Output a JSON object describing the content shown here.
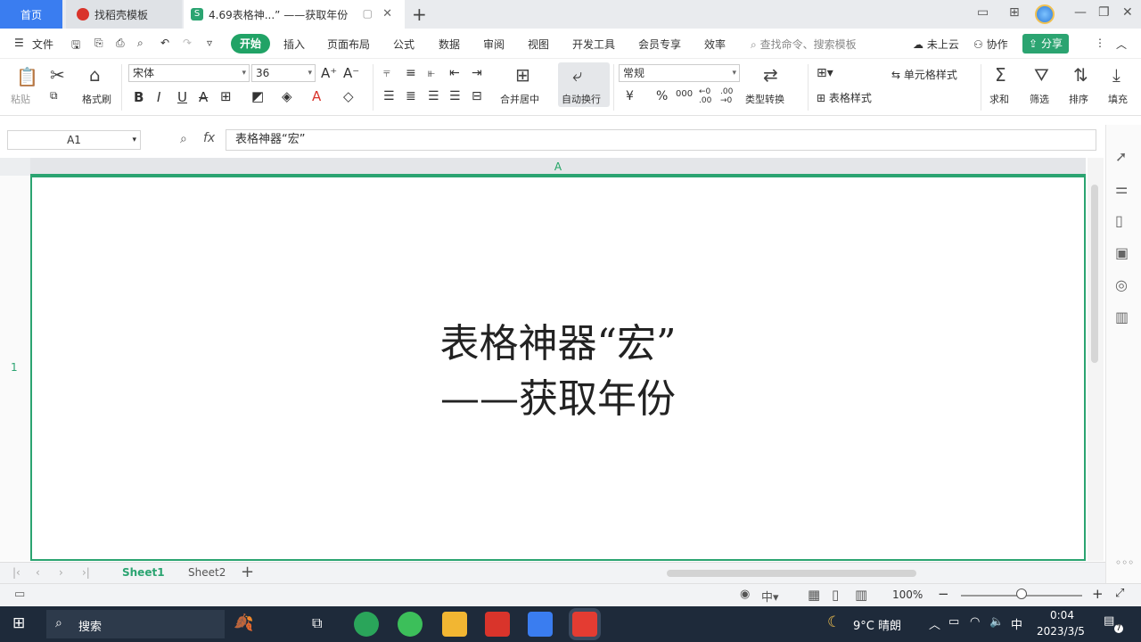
{
  "tabs": {
    "home": "首页",
    "template": "找稻壳模板",
    "document": "4.69表格神...”  ——获取年份"
  },
  "menu": [
    "文件",
    "开始",
    "插入",
    "页面布局",
    "公式",
    "数据",
    "审阅",
    "视图",
    "开发工具",
    "会员专享",
    "效率"
  ],
  "search_cmd": "查找命令、搜索模板",
  "cloud": "未上云",
  "collab": "协作",
  "share": "分享",
  "ribbon": {
    "paste": "粘贴",
    "format_painter": "格式刷",
    "font": "宋体",
    "font_size": "36",
    "merge": "合并居中",
    "wrap": "自动换行",
    "number_format": "常规",
    "convert": "类型转换",
    "cell_style": "单元格样式",
    "table_style": "表格样式",
    "sum": "求和",
    "filter": "筛选",
    "sort": "排序",
    "fill": "填充"
  },
  "formula": {
    "name_box": "A1",
    "fx": "fx",
    "content": "表格神器“宏”"
  },
  "grid": {
    "col": "A",
    "row": "1",
    "cell_line1": "表格神器“宏”",
    "cell_line2": "——获取年份"
  },
  "sheets": [
    "Sheet1",
    "Sheet2"
  ],
  "status": {
    "zoom": "100%"
  },
  "taskbar": {
    "search": "搜索",
    "weather": "9°C  晴朗",
    "ime": "中",
    "time": "0:04",
    "date": "2023/3/5",
    "notif": "7"
  },
  "colors": {
    "accent_green": "#2ba471",
    "home_blue": "#3a7df0"
  }
}
